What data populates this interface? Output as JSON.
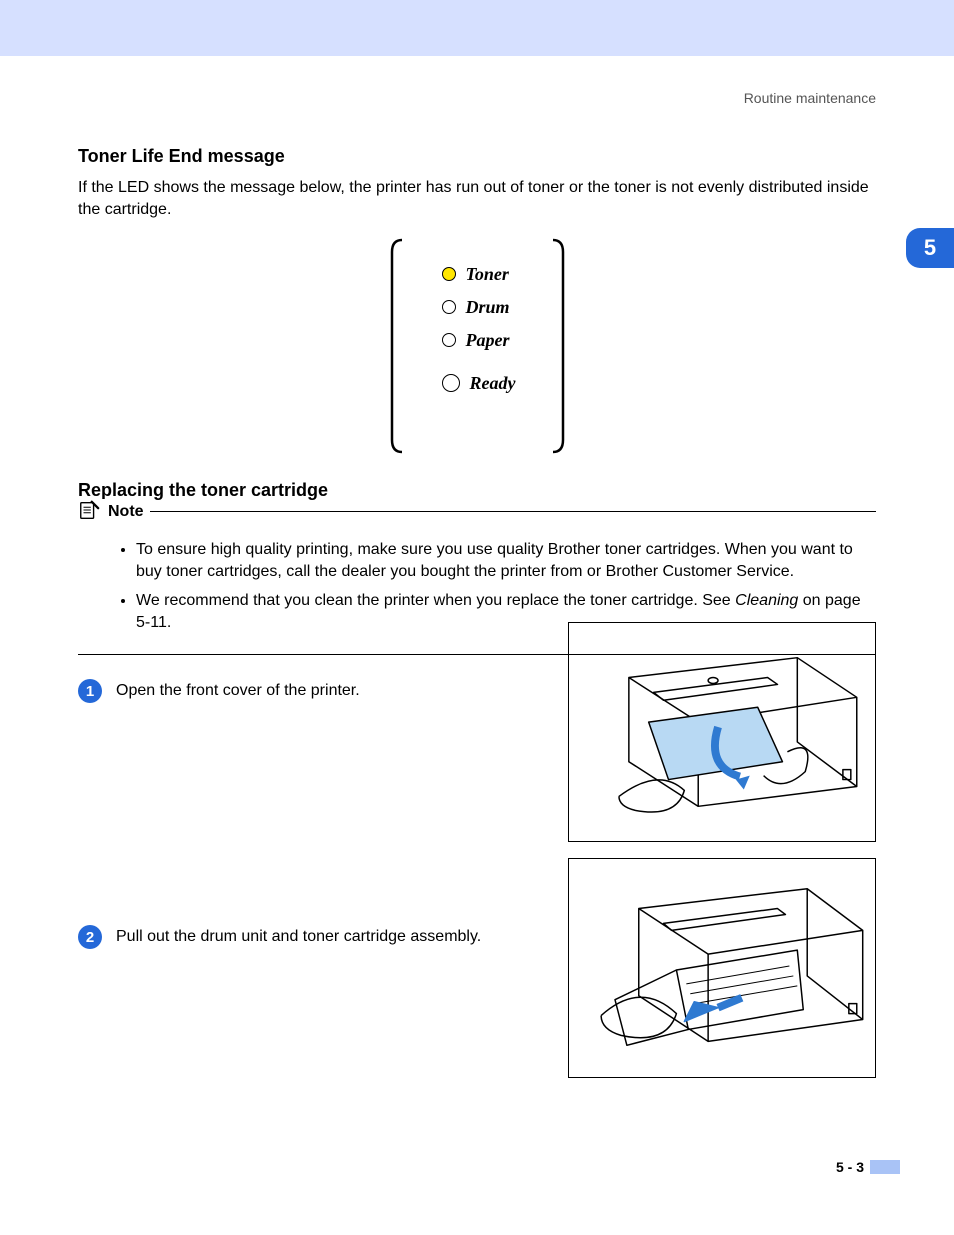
{
  "header": {
    "section": "Routine maintenance"
  },
  "chapter_tab": "5",
  "section1": {
    "title": "Toner Life End message",
    "para": "If the LED shows the message below, the printer has run out of toner or the toner is not evenly distributed inside the cartridge."
  },
  "led_panel": {
    "items": [
      {
        "label": "Toner",
        "state": "on",
        "size": "sm"
      },
      {
        "label": "Drum",
        "state": "off",
        "size": "sm"
      },
      {
        "label": "Paper",
        "state": "off",
        "size": "sm"
      },
      {
        "label": "Ready",
        "state": "off",
        "size": "lg"
      }
    ]
  },
  "section2": {
    "title": "Replacing the toner cartridge"
  },
  "note": {
    "label": "Note",
    "bullets": [
      "To ensure high quality printing, make sure you use quality Brother toner cartridges. When you want to buy toner cartridges, call the dealer you bought the printer from or Brother Customer Service.",
      {
        "pre": "We recommend that you clean the printer when you replace the toner cartridge. See ",
        "link": "Cleaning",
        "post": " on page 5-11."
      }
    ]
  },
  "steps": [
    {
      "num": "1",
      "text": "Open the front cover of the printer."
    },
    {
      "num": "2",
      "text": "Pull out the drum unit and toner cartridge assembly."
    }
  ],
  "footer": {
    "page": "5 - 3"
  }
}
